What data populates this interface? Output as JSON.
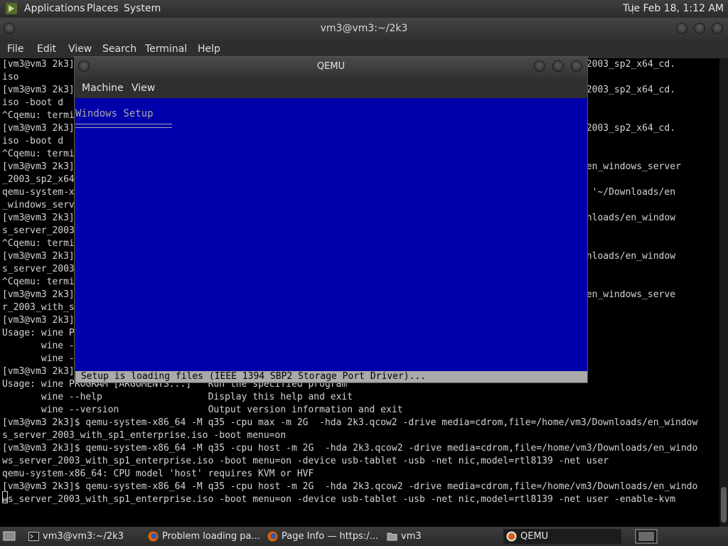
{
  "top_panel": {
    "menu": [
      "Applications",
      "Places",
      "System"
    ],
    "clock": "Tue Feb 18, 1:12 AM"
  },
  "terminal": {
    "title": "vm3@vm3:~/2k3",
    "menu": [
      "File",
      "Edit",
      "View",
      "Search",
      "Terminal",
      "Help"
    ],
    "lines": [
      "[vm3@vm3 2k3]                                                                                      erver_2003_sp2_x64_cd.",
      "iso",
      "[vm3@vm3 2k3]                                                                                      erver_2003_sp2_x64_cd.",
      "iso -boot d",
      "^Cqemu: termi",
      "[vm3@vm3 2k3]                                                                                      erver_2003_sp2_x64_cd.",
      "iso -boot d",
      "^Cqemu: termi",
      "[vm3@vm3 2k3]                                                                                      loads/en_windows_server",
      "_2003_sp2_x64",
      "qemu-system-x                                                                                      t open '~/Downloads/en",
      "_windows_serv",
      "[vm3@vm3 2k3]                                                                                      m3/Downloads/en_window",
      "s_server_2003",
      "^Cqemu: termi",
      "[vm3@vm3 2k3]                                                                                      m3/Downloads/en_window",
      "s_server_2003",
      "^Cqemu: termi",
      "[vm3@vm3 2k3]                                                                                      loads/en_windows_serve",
      "r_2003_with_s",
      "[vm3@vm3 2k3]",
      "Usage: wine P",
      "       wine -",
      "       wine -",
      "[vm3@vm3 2k3]",
      "Usage: wine PROGRAM [ARGUMENTS...]   Run the specified program",
      "       wine --help                   Display this help and exit",
      "       wine --version                Output version information and exit",
      "[vm3@vm3 2k3]$ qemu-system-x86_64 -M q35 -cpu max -m 2G  -hda 2k3.qcow2 -drive media=cdrom,file=/home/vm3/Downloads/en_window",
      "s_server_2003_with_sp1_enterprise.iso -boot menu=on",
      "[vm3@vm3 2k3]$ qemu-system-x86_64 -M q35 -cpu host -m 2G  -hda 2k3.qcow2 -drive media=cdrom,file=/home/vm3/Downloads/en_windo",
      "ws_server_2003_with_sp1_enterprise.iso -boot menu=on -device usb-tablet -usb -net nic,model=rtl8139 -net user",
      "qemu-system-x86_64: CPU model 'host' requires KVM or HVF",
      "[vm3@vm3 2k3]$ qemu-system-x86_64 -M q35 -cpu host -m 2G  -hda 2k3.qcow2 -drive media=cdrom,file=/home/vm3/Downloads/en_windo",
      "ws_server_2003_with_sp1_enterprise.iso -boot menu=on -device usb-tablet -usb -net nic,model=rtl8139 -net user -enable-kvm"
    ]
  },
  "qemu": {
    "title": "QEMU",
    "menu": [
      "Machine",
      "View"
    ],
    "setup_title": "Windows Setup",
    "status": " Setup is loading files (IEEE 1394 SBP2 Storage Port Driver)..."
  },
  "taskbar": {
    "items": [
      {
        "label": "vm3@vm3:~/2k3",
        "icon": "terminal-icon"
      },
      {
        "label": "Problem loading pa...",
        "icon": "firefox-icon"
      },
      {
        "label": "Page Info — https:/...",
        "icon": "firefox-icon"
      },
      {
        "label": "vm3",
        "icon": "folder-icon"
      },
      {
        "label": "QEMU",
        "icon": "qemu-icon"
      }
    ]
  },
  "colors": {
    "setup_blue": "#0000aa",
    "setup_gray": "#aaaaaa",
    "panel": "#2b2b2b"
  }
}
